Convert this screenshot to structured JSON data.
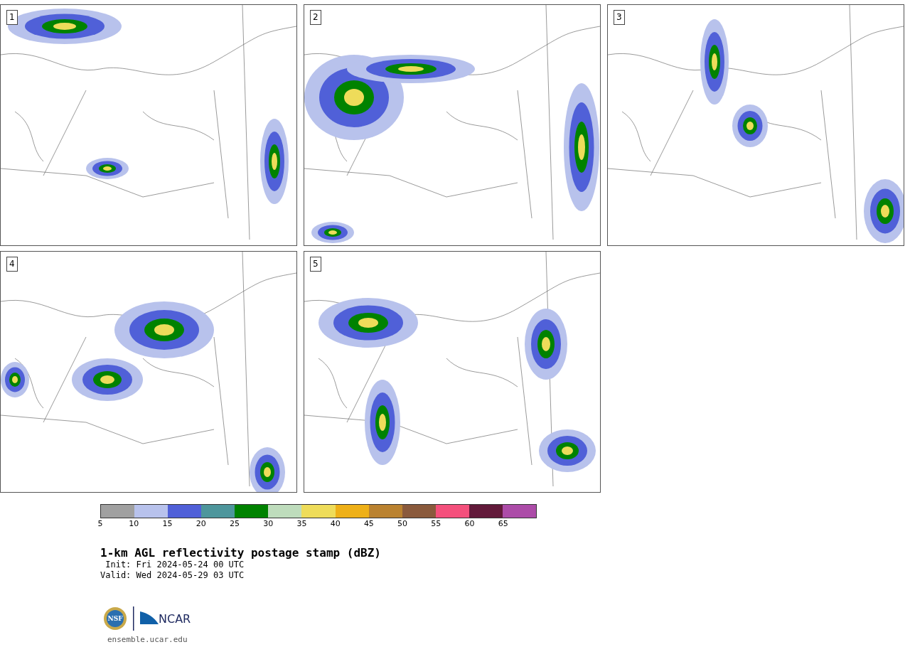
{
  "panels": [
    {
      "label": "1"
    },
    {
      "label": "2"
    },
    {
      "label": "3"
    },
    {
      "label": "4"
    },
    {
      "label": "5"
    }
  ],
  "colorbar": {
    "segments": [
      {
        "color": "#a0a0a0"
      },
      {
        "color": "#b8c2ec"
      },
      {
        "color": "#5060d8"
      },
      {
        "color": "#4e969c"
      },
      {
        "color": "#008200"
      },
      {
        "color": "#bedcbc"
      },
      {
        "color": "#eedc5a"
      },
      {
        "color": "#eeb018"
      },
      {
        "color": "#ba8230"
      },
      {
        "color": "#8a5a3c"
      },
      {
        "color": "#f4507c"
      },
      {
        "color": "#621a3a"
      },
      {
        "color": "#ac4ca8"
      }
    ],
    "ticks": [
      "5",
      "10",
      "15",
      "20",
      "25",
      "30",
      "35",
      "40",
      "45",
      "50",
      "55",
      "60",
      "65"
    ]
  },
  "title": "1-km AGL reflectivity postage stamp (dBZ)",
  "init": " Init: Fri 2024-05-24 00 UTC",
  "valid": "Valid: Wed 2024-05-29 03 UTC",
  "logos": {
    "nsf": "NSF",
    "ncar": "NCAR"
  },
  "url": "ensemble.ucar.edu"
}
